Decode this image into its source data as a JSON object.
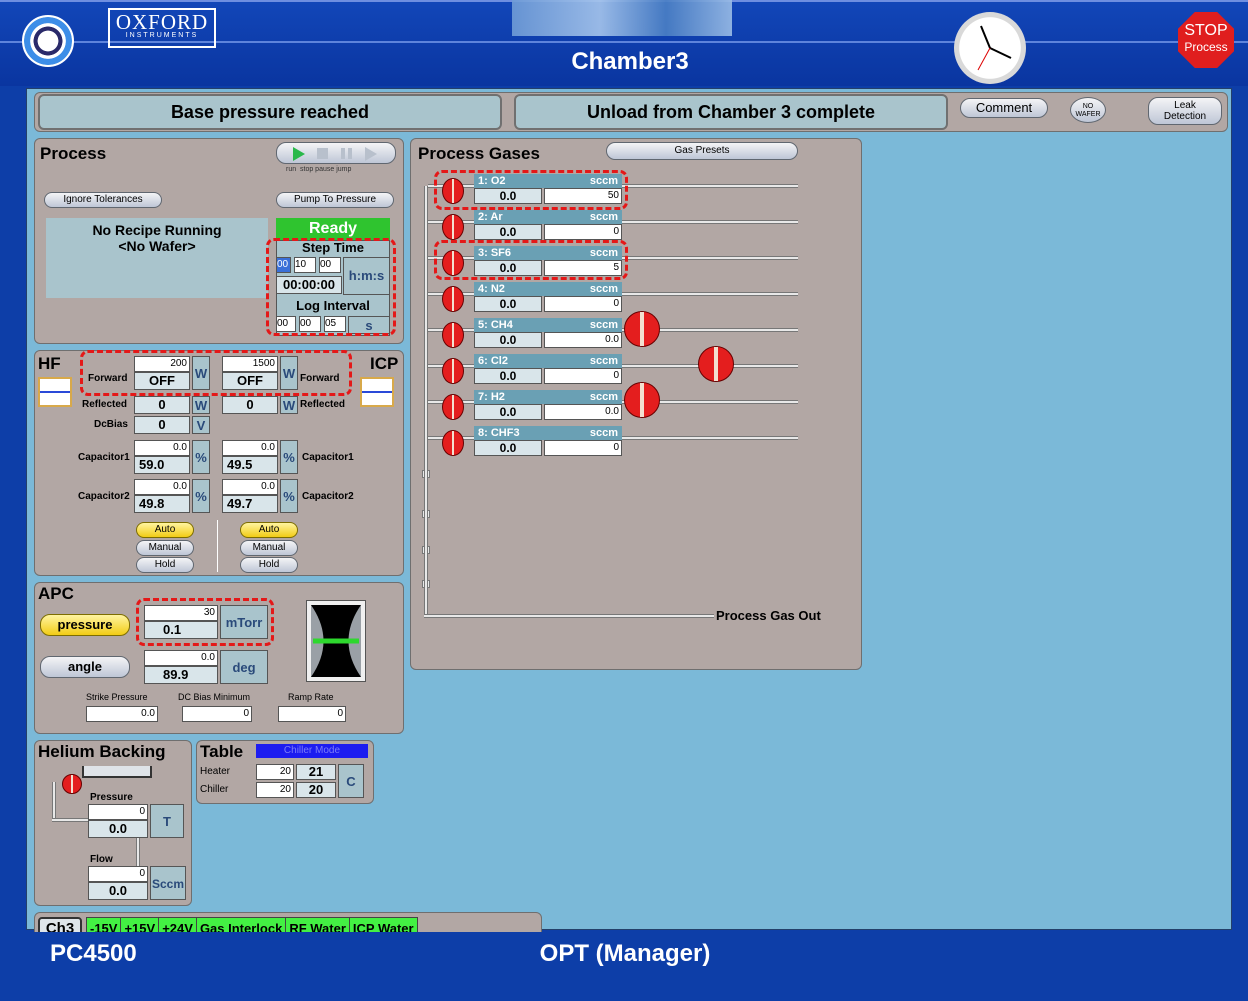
{
  "header": {
    "logo_text": "OXFORD",
    "logo_sub": "INSTRUMENTS",
    "title": "Chamber3",
    "stop_line1": "STOP",
    "stop_line2": "Process"
  },
  "status_bar": {
    "left": "Base pressure reached",
    "right": "Unload from Chamber 3 complete",
    "comment": "Comment",
    "no_wafer_1": "NO",
    "no_wafer_2": "WAFER",
    "leak_1": "Leak",
    "leak_2": "Detection"
  },
  "process": {
    "title": "Process",
    "ctrl_labels": "run  stop pause jump",
    "ignore": "Ignore Tolerances",
    "pump": "Pump To Pressure",
    "recipe": "No Recipe Running",
    "wafer": "<No Wafer>",
    "state": "Ready",
    "step_time_label": "Step Time",
    "step_h": "00",
    "step_m": "10",
    "step_s": "00",
    "hms": "h:m:s",
    "step_elapsed": "00:00:00",
    "log_label": "Log Interval",
    "log_h": "00",
    "log_m": "00",
    "log_s": "05",
    "s": "s"
  },
  "rf": {
    "hf": "HF",
    "icp": "ICP",
    "forward": "Forward",
    "reflected": "Reflected",
    "dcbias": "DcBias",
    "cap1": "Capacitor1",
    "cap2": "Capacitor2",
    "w": "W",
    "v": "V",
    "pct": "%",
    "hf_fwd_set": "200",
    "hf_fwd_val": "OFF",
    "hf_ref": "0",
    "hf_dc": "0",
    "hf_c1_set": "0.0",
    "hf_c1": "59.0",
    "hf_c2_set": "0.0",
    "hf_c2": "49.8",
    "icp_fwd_set": "1500",
    "icp_fwd_val": "OFF",
    "icp_ref": "0",
    "icp_c1_set": "0.0",
    "icp_c1": "49.5",
    "icp_c2_set": "0.0",
    "icp_c2": "49.7",
    "auto": "Auto",
    "manual": "Manual",
    "hold": "Hold"
  },
  "apc": {
    "title": "APC",
    "pressure_btn": "pressure",
    "angle_btn": "angle",
    "p_set": "30",
    "p_val": "0.1",
    "p_unit": "mTorr",
    "a_set": "0.0",
    "a_val": "89.9",
    "a_unit": "deg",
    "strike_lbl": "Strike Pressure",
    "strike": "0.0",
    "dcmin_lbl": "DC Bias Minimum",
    "dcmin": "0",
    "ramp_lbl": "Ramp Rate",
    "ramp": "0",
    "valve_angle_pct": 0.5
  },
  "helium": {
    "title": "Helium Backing",
    "pressure_lbl": "Pressure",
    "p_set": "0",
    "p_val": "0.0",
    "p_unit": "T",
    "flow_lbl": "Flow",
    "f_set": "0",
    "f_val": "0.0",
    "f_unit": "Sccm"
  },
  "table": {
    "title": "Table",
    "mode": "Chiller Mode",
    "heater": "Heater",
    "chiller": "Chiller",
    "h_set": "20",
    "h_val": "21",
    "c_set": "20",
    "c_val": "20",
    "unit": "C"
  },
  "gases": {
    "title": "Process Gases",
    "presets": "Gas Presets",
    "out": "Process Gas Out",
    "unit": "sccm",
    "lines": [
      {
        "label": "1:  O2",
        "actual": "0.0",
        "set": "50"
      },
      {
        "label": "2:  Ar",
        "actual": "0.0",
        "set": "0"
      },
      {
        "label": "3:  SF6",
        "actual": "0.0",
        "set": "5"
      },
      {
        "label": "4:  N2",
        "actual": "0.0",
        "set": "0"
      },
      {
        "label": "5:  CH4",
        "actual": "0.0",
        "set": "0.0"
      },
      {
        "label": "6:  Cl2",
        "actual": "0.0",
        "set": "0"
      },
      {
        "label": "7:  H2",
        "actual": "0.0",
        "set": "0.0"
      },
      {
        "label": "8:  CHF3",
        "actual": "0.0",
        "set": "0"
      }
    ]
  },
  "interlocks": {
    "ch": "Ch3",
    "items": [
      "-15V",
      "+15V",
      "+24V",
      "Gas Interlock",
      "RF Water",
      "ICP Water"
    ]
  },
  "footer": {
    "pc": "PC4500",
    "user": "OPT (Manager)"
  },
  "colors": {
    "background": "#0d3ea8",
    "panel": "#b2a7a4",
    "main": "#7bb9d8",
    "ok_green": "#43f043",
    "valve_red": "#e41e1e"
  }
}
